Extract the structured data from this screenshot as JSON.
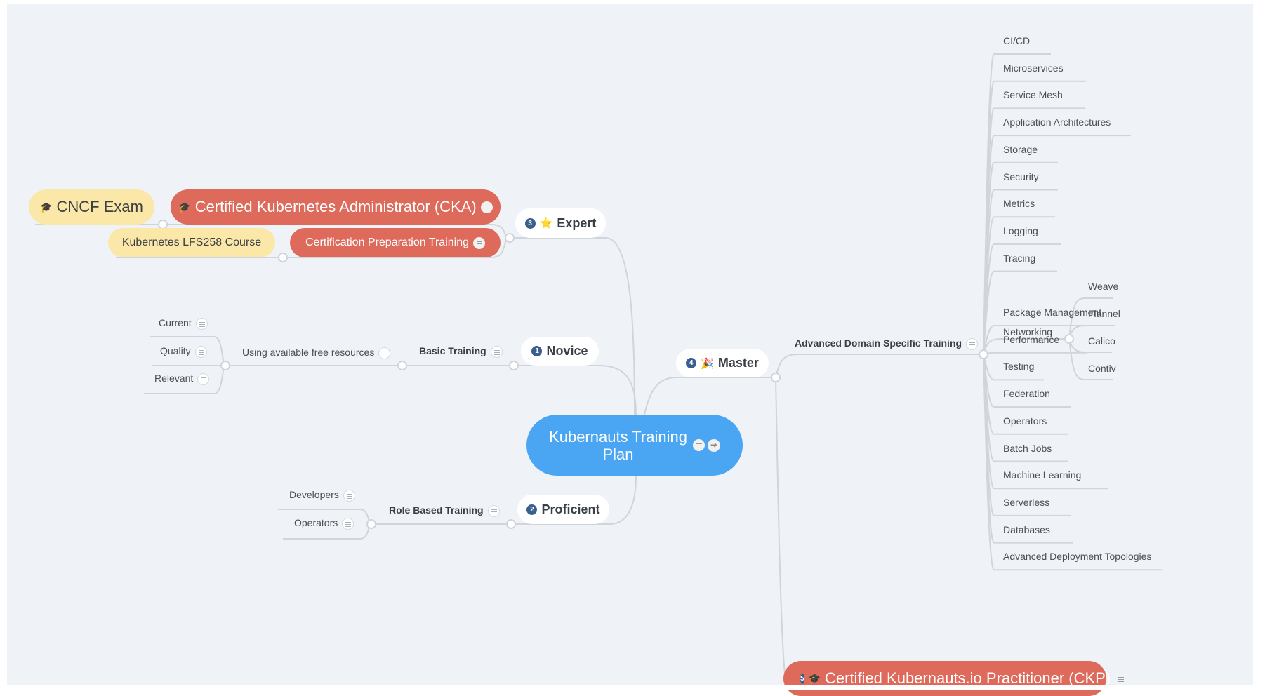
{
  "root": {
    "title": "Kubernauts Training Plan",
    "title_line1": "Kubernauts Training",
    "title_line2": "Plan",
    "icons": [
      "notes-icon",
      "arrow-right-icon"
    ]
  },
  "colors": {
    "canvas": "#eff3f7",
    "root": "#4aa6f2",
    "red_node": "#dd6a5b",
    "yellow_node": "#fbe8a9",
    "badge": "#3a5f8f",
    "connector": "#cfd5db"
  },
  "branches": {
    "expert": {
      "number": "3",
      "emoji": "⭐",
      "label": "Expert",
      "children": {
        "cka": {
          "icon": "graduation-cap-icon",
          "label": "Certified Kubernetes Administrator (CKA)",
          "sub": {
            "icon": "graduation-cap-icon",
            "label": "CNCF Exam"
          }
        },
        "prep": {
          "label": "Certification Preparation Training",
          "sub": {
            "label": "Kubernetes LFS258 Course"
          }
        }
      }
    },
    "novice": {
      "number": "1",
      "label": "Novice",
      "child": {
        "label": "Basic Training",
        "child": {
          "label": "Using available free resources",
          "children": [
            "Current",
            "Quality",
            "Relevant"
          ]
        }
      }
    },
    "proficient": {
      "number": "2",
      "label": "Proficient",
      "child": {
        "label": "Role Based Training",
        "children": [
          "Developers",
          "Operators"
        ]
      }
    },
    "master": {
      "number": "4",
      "emoji": "🎉",
      "label": "Master",
      "child": {
        "label": "Advanced Domain Specific Training",
        "topics": [
          "CI/CD",
          "Microservices",
          "Service Mesh",
          "Application Architectures",
          "Storage",
          "Security",
          "Metrics",
          "Logging",
          "Tracing",
          "Networking",
          "Package Management",
          "Performance",
          "Testing",
          "Federation",
          "Operators",
          "Batch Jobs",
          "Machine Learning",
          "Serverless",
          "Databases",
          "Advanced Deployment Topologies"
        ],
        "networking_children": [
          "Weave",
          "Flannel",
          "Calico",
          "Contiv"
        ]
      }
    },
    "ckp": {
      "number": "5",
      "icon": "graduation-cap-icon",
      "label": "Certified Kubernauts.io Practitioner (CKP)"
    }
  }
}
